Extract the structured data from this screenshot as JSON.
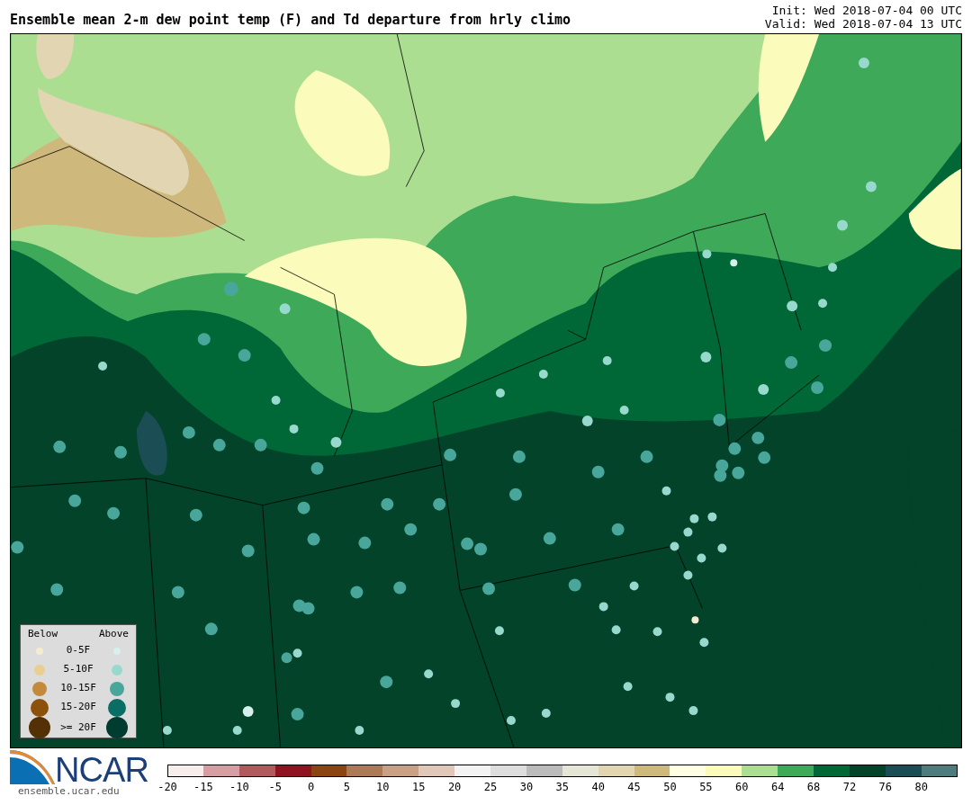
{
  "title": "Ensemble mean 2-m dew point temp (F) and Td departure from hrly climo",
  "init": "Init: Wed 2018-07-04 00 UTC",
  "valid": "Valid: Wed 2018-07-04 13 UTC",
  "legend": {
    "below_label": "Below",
    "above_label": "Above",
    "rows": [
      {
        "label": "0-5F",
        "below": {
          "color": "#f5ecd0"
        },
        "above": {
          "color": "#d6f0eb"
        }
      },
      {
        "label": "5-10F",
        "below": {
          "color": "#e8cf8f"
        },
        "above": {
          "color": "#97d9cc"
        }
      },
      {
        "label": "10-15F",
        "below": {
          "color": "#c38a3c"
        },
        "above": {
          "color": "#48a79a"
        }
      },
      {
        "label": "15-20F",
        "below": {
          "color": "#8c510a"
        },
        "above": {
          "color": "#0a6e64"
        }
      },
      {
        "label": ">= 20F",
        "below": {
          "color": "#543005"
        },
        "above": {
          "color": "#003c30"
        }
      }
    ]
  },
  "logo": {
    "text": "NCAR",
    "url": "ensemble.ucar.edu"
  },
  "colorbar": {
    "bins": [
      {
        "color": "#f7eded",
        "tick": "-20"
      },
      {
        "color": "#d49ea2",
        "tick": "-15"
      },
      {
        "color": "#b05a5e",
        "tick": "-10"
      },
      {
        "color": "#8e1520",
        "tick": "-5"
      },
      {
        "color": "#8b4513",
        "tick": "0"
      },
      {
        "color": "#ad7a57",
        "tick": "5"
      },
      {
        "color": "#c8a085",
        "tick": "10"
      },
      {
        "color": "#e0c7b7",
        "tick": "15"
      },
      {
        "color": "#f3f3f3",
        "tick": "20"
      },
      {
        "color": "#dddddd",
        "tick": "25"
      },
      {
        "color": "#bbbbbb",
        "tick": "30"
      },
      {
        "color": "#e6e6d6",
        "tick": "35"
      },
      {
        "color": "#e2d6b2",
        "tick": "40"
      },
      {
        "color": "#cfb87b",
        "tick": "45"
      },
      {
        "color": "#ffffe2",
        "tick": "50"
      },
      {
        "color": "#fbfbbb",
        "tick": "55"
      },
      {
        "color": "#acde92",
        "tick": "60"
      },
      {
        "color": "#3fa95a",
        "tick": "64"
      },
      {
        "color": "#006837",
        "tick": "68"
      },
      {
        "color": "#02432a",
        "tick": "72"
      },
      {
        "color": "#1a4d54",
        "tick": "76"
      },
      {
        "color": "#4e7b7c",
        "tick": "80"
      }
    ]
  }
}
